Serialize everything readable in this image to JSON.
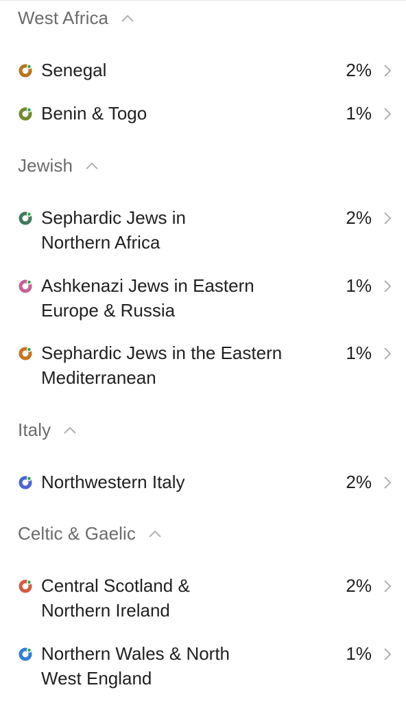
{
  "sections": [
    {
      "title": "West Africa",
      "items": [
        {
          "line1": "Senegal",
          "line2": "",
          "percent": "2%",
          "color": "#b8731a"
        },
        {
          "line1": "Benin & Togo",
          "line2": "",
          "percent": "1%",
          "color": "#6f8a2c"
        }
      ]
    },
    {
      "title": "Jewish",
      "items": [
        {
          "line1": "Sephardic Jews in",
          "line2": "Northern Africa",
          "percent": "2%",
          "color": "#3f7a5a"
        },
        {
          "line1": "Ashkenazi Jews in Eastern",
          "line2": "Europe & Russia",
          "percent": "1%",
          "color": "#c8609a"
        },
        {
          "line1": "Sephardic Jews in the Eastern",
          "line2": "Mediterranean",
          "percent": "1%",
          "color": "#c8731e"
        }
      ]
    },
    {
      "title": "Italy",
      "items": [
        {
          "line1": "Northwestern Italy",
          "line2": "",
          "percent": "2%",
          "color": "#4b63d6"
        }
      ]
    },
    {
      "title": "Celtic & Gaelic",
      "items": [
        {
          "line1": "Central Scotland &",
          "line2": "Northern Ireland",
          "percent": "2%",
          "color": "#d45a3f"
        },
        {
          "line1": "Northern Wales & North",
          "line2": "West England",
          "percent": "1%",
          "color": "#2f7fd8"
        }
      ]
    }
  ],
  "accent_dot_color": "#2ea84a",
  "icons": {
    "section_toggle": "chevron-up-icon",
    "row_arrow": "chevron-right-icon",
    "population_marker": "population-dot-icon"
  }
}
